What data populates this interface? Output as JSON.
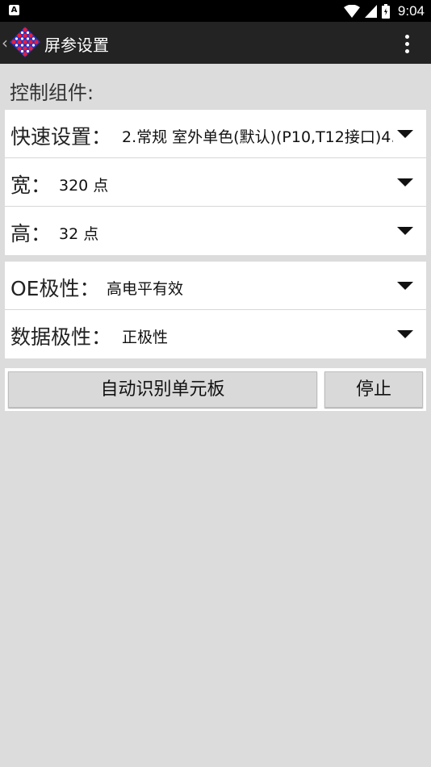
{
  "status_bar": {
    "notification": "A",
    "time": "9:04"
  },
  "app_bar": {
    "title": "屏参设置"
  },
  "section": {
    "title": "控制组件:"
  },
  "settings_group_1": {
    "quick_setup": {
      "label": "快速设置：",
      "value": "2.常规 室外单色(默认)(P10,T12接口)4..."
    },
    "width": {
      "label": "宽：",
      "value": "320 点"
    },
    "height": {
      "label": "高：",
      "value": "32 点"
    }
  },
  "settings_group_2": {
    "oe_polarity": {
      "label": "OE极性：",
      "value": "高电平有效"
    },
    "data_polarity": {
      "label": "数据极性：",
      "value": "正极性"
    }
  },
  "actions": {
    "auto_detect_label": "自动识别单元板",
    "stop_label": "停止"
  },
  "colors": {
    "logo_primary": "#2233cc",
    "logo_secondary": "#e81e3a",
    "app_bar": "#232323"
  }
}
